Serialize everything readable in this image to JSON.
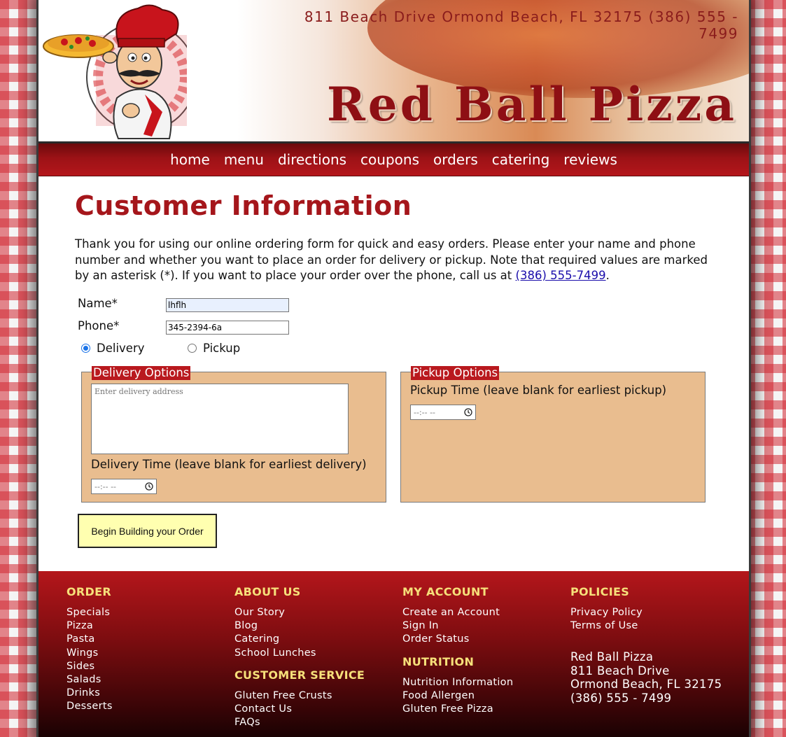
{
  "header": {
    "address_line": "811 Beach Drive  Ormond Beach, FL 32175   (386) 555 - 7499",
    "brand_title": "Red Ball Pizza"
  },
  "nav": {
    "items": [
      "home",
      "menu",
      "directions",
      "coupons",
      "orders",
      "catering",
      "reviews"
    ]
  },
  "main": {
    "title": "Customer Information",
    "intro_text": "Thank you for using our online ordering form for quick and easy orders. Please enter your name and phone number and whether you want to place an order for delivery or pickup. Note that required values are marked by an asterisk (*). If you want to place your order over the phone, call us at ",
    "intro_phone_link": "(386) 555-7499",
    "intro_end": "."
  },
  "form": {
    "name_label": "Name*",
    "name_value": "lhflh",
    "phone_label": "Phone*",
    "phone_value": "345-2394-6a",
    "delivery_label": "Delivery",
    "pickup_label": "Pickup",
    "selected_option": "Delivery",
    "delivery_options": {
      "legend": "Delivery Options",
      "address_placeholder": "Enter delivery address",
      "time_label": "Delivery Time (leave blank for earliest delivery)",
      "time_value": "--:-- --"
    },
    "pickup_options": {
      "legend": "Pickup Options",
      "time_label": "Pickup Time (leave blank for earliest pickup)",
      "time_value": "--:-- --"
    },
    "submit_label": "Begin Building your Order"
  },
  "footer": {
    "order": {
      "heading": "ORDER",
      "links": [
        "Specials",
        "Pizza",
        "Pasta",
        "Wings",
        "Sides",
        "Salads",
        "Drinks",
        "Desserts"
      ]
    },
    "about": {
      "heading": "ABOUT US",
      "links": [
        "Our Story",
        "Blog",
        "Catering",
        "School Lunches"
      ]
    },
    "customer_service": {
      "heading": "CUSTOMER SERVICE",
      "links": [
        "Gluten Free Crusts",
        "Contact Us",
        "FAQs"
      ]
    },
    "account": {
      "heading": "MY ACCOUNT",
      "links": [
        "Create an Account",
        "Sign In",
        "Order Status"
      ]
    },
    "nutrition": {
      "heading": "NUTRITION",
      "links": [
        "Nutrition Information",
        "Food Allergen",
        "Gluten Free Pizza"
      ]
    },
    "policies": {
      "heading": "POLICIES",
      "links": [
        "Privacy Policy",
        "Terms of Use"
      ]
    },
    "address": {
      "name": "Red Ball Pizza",
      "street": "811 Beach Drive",
      "city": "Ormond Beach, FL 32175",
      "phone": "(386) 555 - 7499"
    }
  },
  "colors": {
    "brand_red": "#a5161b",
    "footer_heading": "#f6e07a",
    "options_bg": "#e9bd8f",
    "button_bg": "#ffffb0"
  }
}
